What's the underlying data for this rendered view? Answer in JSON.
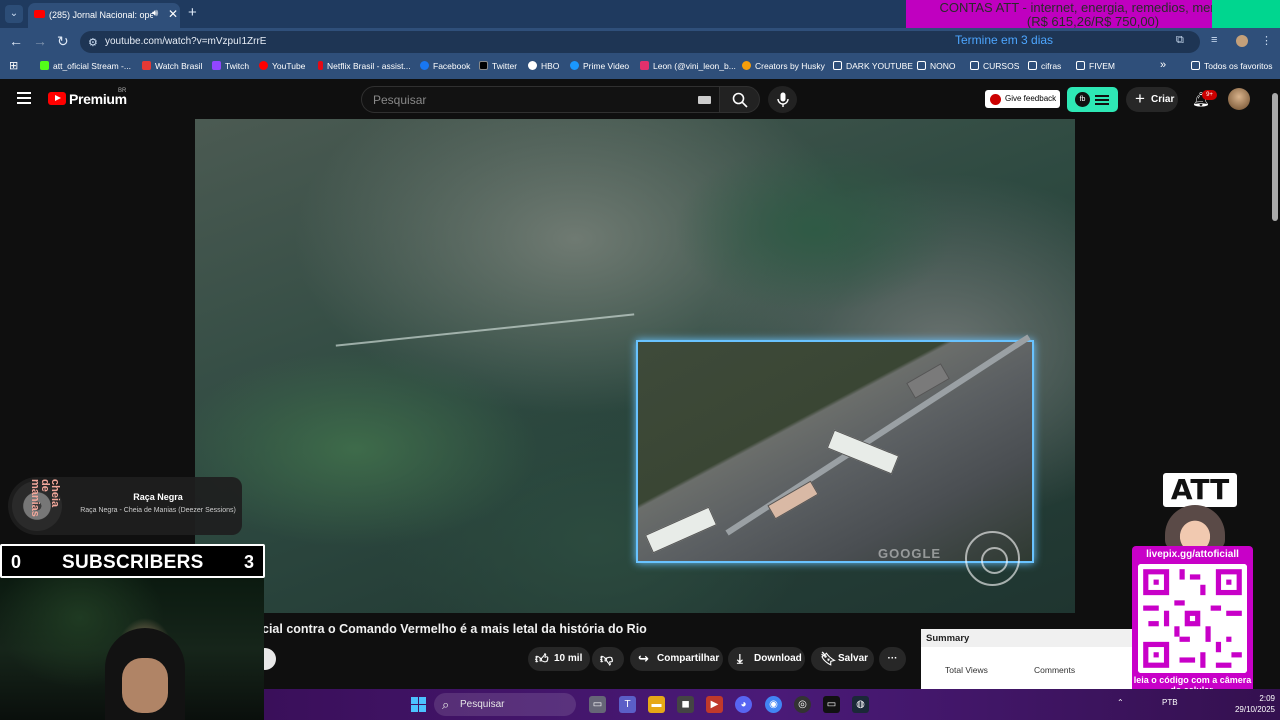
{
  "browser": {
    "tab_title": "(285) Jornal Nacional: operaç",
    "url": "youtube.com/watch?v=mVzpuI1ZrrE",
    "ticker": "Termine em 3 dias",
    "bookmarks": [
      {
        "label": "att_oficial Stream -...",
        "color": "#53fc18"
      },
      {
        "label": "Watch Brasil",
        "color": "#e53935"
      },
      {
        "label": "Twitch",
        "color": "#9146ff"
      },
      {
        "label": "YouTube",
        "color": "#ff0000"
      },
      {
        "label": "Netflix Brasil - assist...",
        "color": "#e50914"
      },
      {
        "label": "Facebook",
        "color": "#1877f2"
      },
      {
        "label": "Twitter",
        "color": "#000000"
      },
      {
        "label": "HBO",
        "color": "#ffffff"
      },
      {
        "label": "Prime Video",
        "color": "#1a98ff"
      },
      {
        "label": "Leon (@vini_leon_b...",
        "color": "#e1306c"
      },
      {
        "label": "Creators by Husky",
        "color": "#f59e0b"
      },
      {
        "label": "DARK YOUTUBE",
        "color": "folder"
      },
      {
        "label": "NONO",
        "color": "folder"
      },
      {
        "label": "CURSOS",
        "color": "folder"
      },
      {
        "label": "cifras",
        "color": "folder"
      },
      {
        "label": "FIVEM",
        "color": "folder"
      }
    ],
    "more_bookmarks": "»",
    "all_favorites": "Todos os favoritos"
  },
  "banner": {
    "line1": "CONTAS ATT - internet, energia, remedios, mercado!",
    "line2": "(R$ 615,26/R$ 750,00)"
  },
  "youtube": {
    "logo_text": "Premium",
    "logo_region": "BR",
    "search_placeholder": "Pesquisar",
    "feedback": "Give feedback",
    "create": "Criar",
    "notifications": "9+",
    "ext_badge": "fb"
  },
  "video": {
    "title": "cial contra o Comando Vermelho é a mais letal da história do Rio",
    "likes": "10 mil",
    "share": "Compartilhar",
    "download": "Download",
    "save": "Salvar",
    "more": "···",
    "watermark": "GOOGLE"
  },
  "summary": {
    "heading": "Summary",
    "col1": "Total Views",
    "col2": "Comments"
  },
  "now_playing": {
    "disc_text": "cheia de manias",
    "artist": "Raça Negra",
    "track": "Raça Negra - Cheia de Manias (Deezer Sessions)"
  },
  "subscribers": {
    "left": "0",
    "label": "SUBSCRIBERS",
    "right": "3"
  },
  "att": {
    "logo": "ATT",
    "qr_url": "livepix.gg/attoficiall",
    "qr_caption": "leia o código com a câmera do celular."
  },
  "taskbar": {
    "search": "Pesquisar",
    "lang": "PTB",
    "time": "2:09",
    "date": "29/10/2025"
  }
}
